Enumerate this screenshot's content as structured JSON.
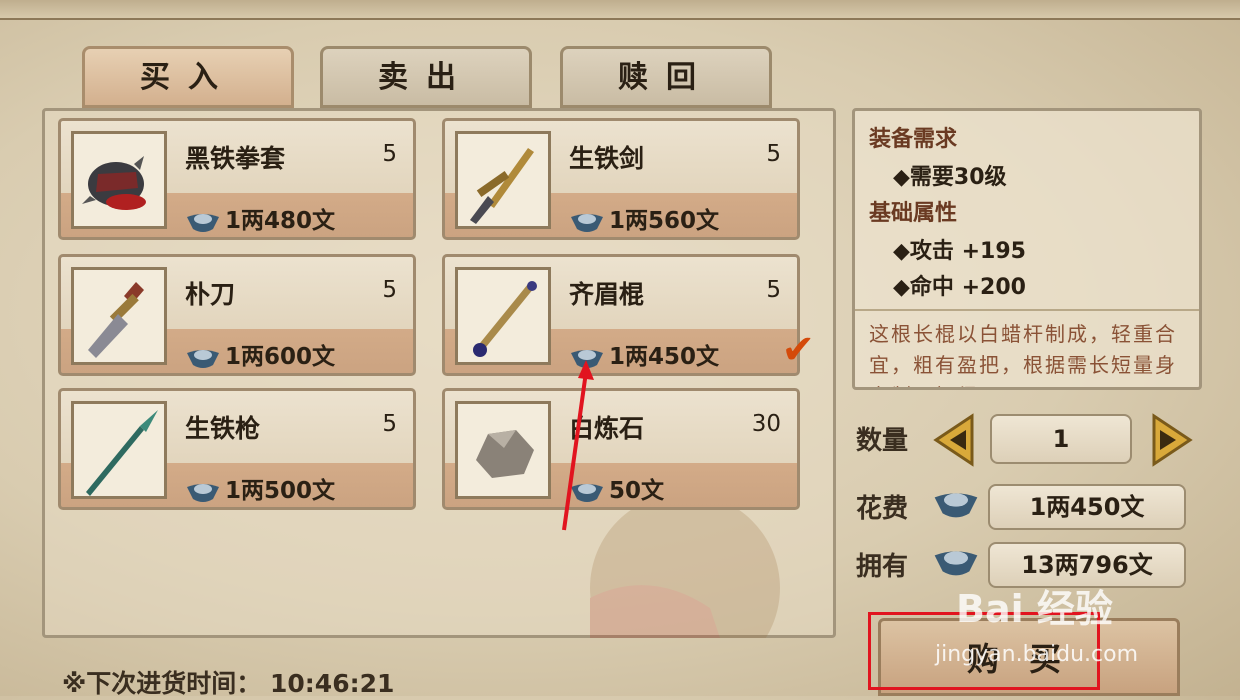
{
  "tabs": [
    {
      "label": "买入",
      "active": true
    },
    {
      "label": "卖出",
      "active": false
    },
    {
      "label": "赎回",
      "active": false
    }
  ],
  "items": [
    {
      "name": "黑铁拳套",
      "qty": "5",
      "price": "1两480文",
      "icon": "iron-gauntlet-icon"
    },
    {
      "name": "生铁剑",
      "qty": "5",
      "price": "1两560文",
      "icon": "iron-sword-icon"
    },
    {
      "name": "朴刀",
      "qty": "5",
      "price": "1两600文",
      "icon": "broadsword-icon"
    },
    {
      "name": "齐眉棍",
      "qty": "5",
      "price": "1两450文",
      "icon": "staff-icon",
      "selected": true
    },
    {
      "name": "生铁枪",
      "qty": "5",
      "price": "1两500文",
      "icon": "spear-icon"
    },
    {
      "name": "白炼石",
      "qty": "30",
      "price": "50文",
      "icon": "refining-stone-icon"
    }
  ],
  "details": {
    "requirement_heading": "装备需求",
    "requirement": "◆需要30级",
    "attributes_heading": "基础属性",
    "attributes": [
      "◆攻击 +195",
      "◆命中 +200"
    ],
    "description": "这根长棍以白蜡杆制成，轻重合宜，粗有盈把，根据需长短量身定制，好得"
  },
  "purchase": {
    "quantity_label": "数量",
    "quantity_value": "1",
    "cost_label": "花费",
    "cost_value": "1两450文",
    "owned_label": "拥有",
    "owned_value": "13两796文",
    "buy_label": "购买"
  },
  "restock": "※下次进货时间： 10:46:21",
  "watermark": {
    "brand": "Bai 经验",
    "url": "jingyan.baidu.com"
  },
  "colors": {
    "accent_red": "#e1141f",
    "check": "#d44a0a"
  }
}
